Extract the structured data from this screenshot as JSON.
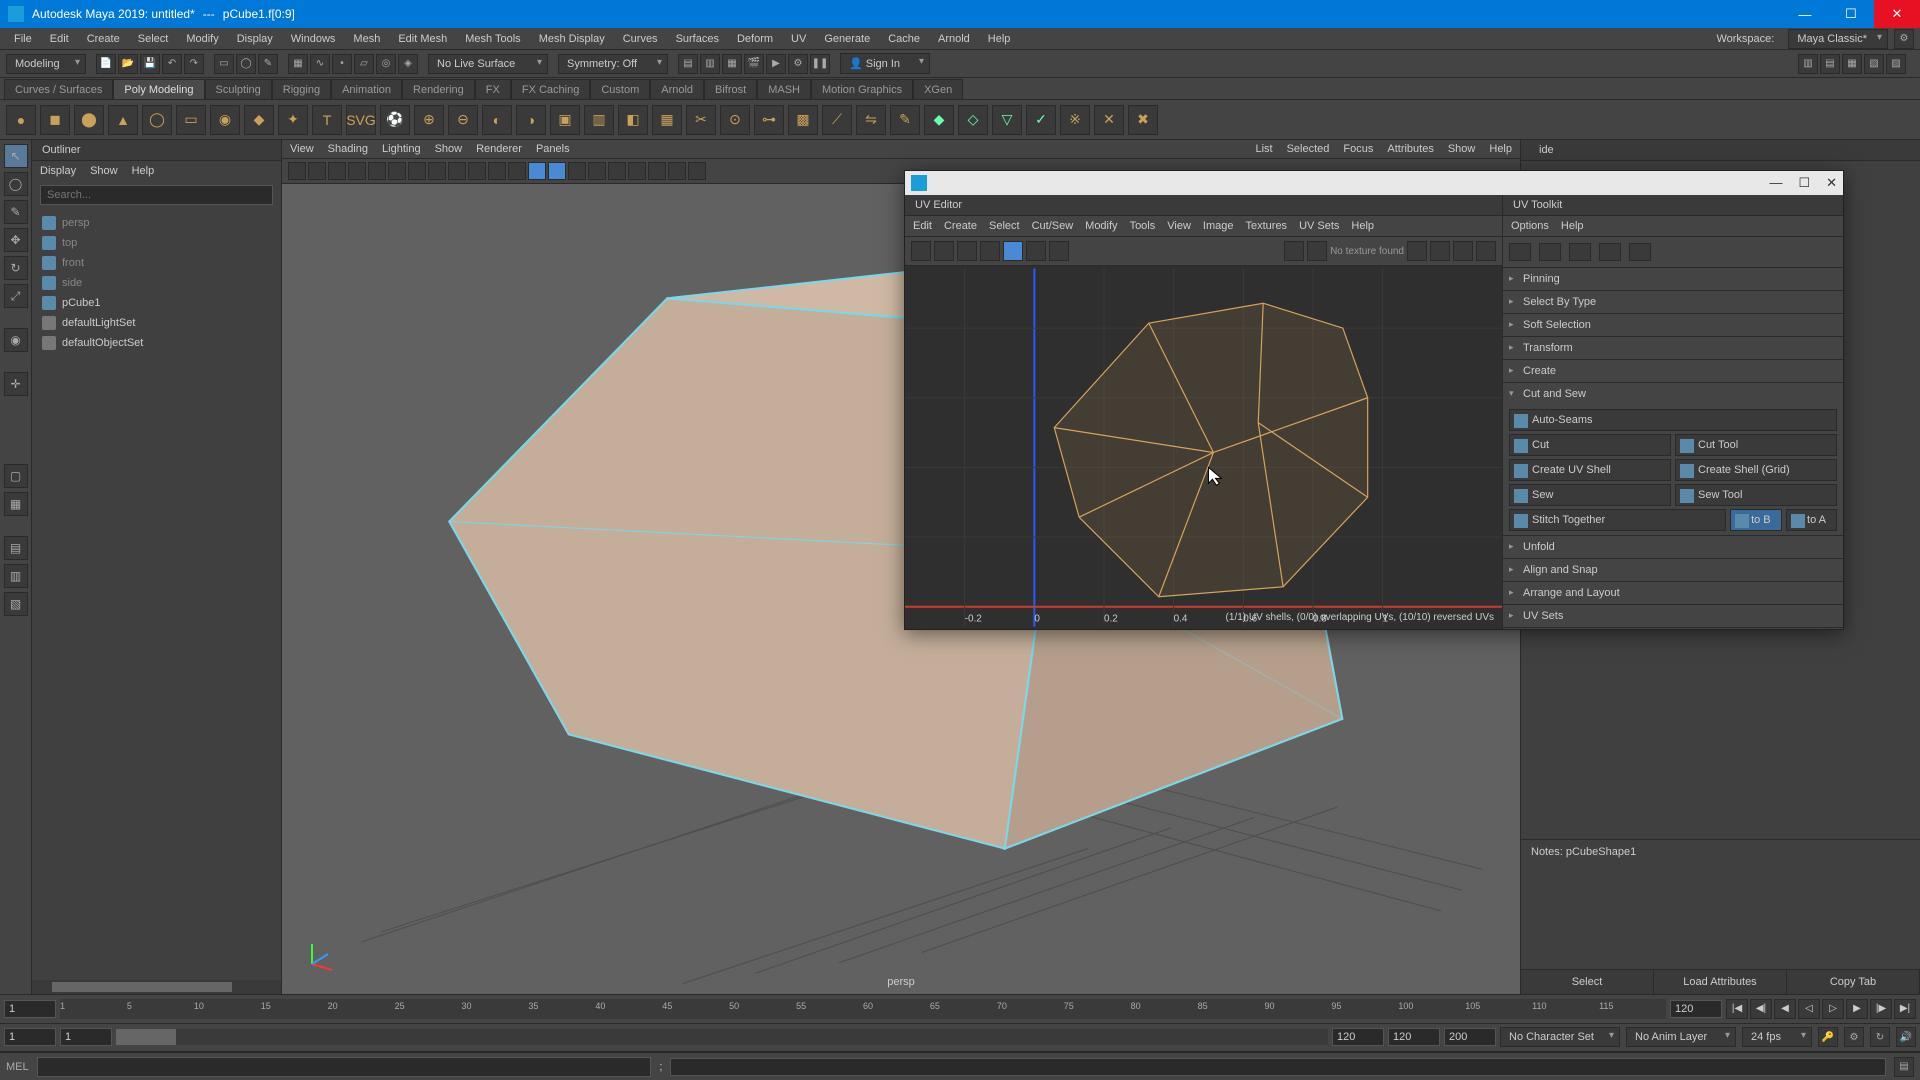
{
  "titlebar": {
    "app": "Autodesk Maya 2019: untitled*",
    "sep": "---",
    "sel": "pCube1.f[0:9]"
  },
  "menubar": {
    "items": [
      "File",
      "Edit",
      "Create",
      "Select",
      "Modify",
      "Display",
      "Windows",
      "Mesh",
      "Edit Mesh",
      "Mesh Tools",
      "Mesh Display",
      "Curves",
      "Surfaces",
      "Deform",
      "UV",
      "Generate",
      "Cache",
      "Arnold",
      "Help"
    ],
    "workspace_lbl": "Workspace:",
    "workspace": "Maya Classic*"
  },
  "toolbar": {
    "mode": "Modeling",
    "livesurf": "No Live Surface",
    "symmetry": "Symmetry: Off",
    "signin": "Sign In"
  },
  "shelf_tabs": [
    "Curves / Surfaces",
    "Poly Modeling",
    "Sculpting",
    "Rigging",
    "Animation",
    "Rendering",
    "FX",
    "FX Caching",
    "Custom",
    "Arnold",
    "Bifrost",
    "MASH",
    "Motion Graphics",
    "XGen"
  ],
  "shelf_active": 1,
  "outliner": {
    "title": "Outliner",
    "menus": [
      "Display",
      "Show",
      "Help"
    ],
    "search_ph": "Search...",
    "items": [
      {
        "name": "persp",
        "dim": true
      },
      {
        "name": "top",
        "dim": true
      },
      {
        "name": "front",
        "dim": true
      },
      {
        "name": "side",
        "dim": true
      },
      {
        "name": "pCube1",
        "dim": false
      },
      {
        "name": "defaultLightSet",
        "dim": false,
        "grey": true
      },
      {
        "name": "defaultObjectSet",
        "dim": false,
        "grey": true
      }
    ]
  },
  "viewport": {
    "menus_l": [
      "View",
      "Shading",
      "Lighting",
      "Show",
      "Renderer",
      "Panels"
    ],
    "menus_r": [
      "List",
      "Selected",
      "Focus",
      "Attributes",
      "Show",
      "Help"
    ],
    "camera": "persp"
  },
  "uv": {
    "editor_title": "UV Editor",
    "editor_menus": [
      "Edit",
      "Create",
      "Select",
      "Cut/Sew",
      "Modify",
      "Tools",
      "View",
      "Image",
      "Textures",
      "UV Sets",
      "Help"
    ],
    "no_tex": "No texture found",
    "status": "(1/1) UV shells, (0/0) overlapping UVs, (10/10) reversed UVs",
    "toolkit_title": "UV Toolkit",
    "toolkit_menus": [
      "Options",
      "Help"
    ],
    "sections": {
      "pinning": "Pinning",
      "selbytype": "Select By Type",
      "softsel": "Soft Selection",
      "transform": "Transform",
      "create": "Create",
      "cutsew": "Cut and Sew",
      "unfold": "Unfold",
      "alignsnap": "Align and Snap",
      "arrange": "Arrange and Layout",
      "uvsets": "UV Sets"
    },
    "cutsew": {
      "autoseams": "Auto-Seams",
      "cut": "Cut",
      "cuttool": "Cut Tool",
      "createshell": "Create UV Shell",
      "createshellgrid": "Create Shell (Grid)",
      "sew": "Sew",
      "sewtool": "Sew Tool",
      "stitch": "Stitch Together",
      "atob": "A to B",
      "btoa": "B to A"
    }
  },
  "attr": {
    "tab": "ide",
    "notes": "Notes:  pCubeShape1",
    "btns": [
      "Select",
      "Load Attributes",
      "Copy Tab"
    ]
  },
  "timeline": {
    "ticks": [
      1,
      5,
      10,
      15,
      20,
      25,
      30,
      35,
      40,
      45,
      50,
      55,
      60,
      65,
      70,
      75,
      80,
      85,
      90,
      95,
      100,
      105,
      110,
      115,
      120
    ],
    "start": "1",
    "end": "120",
    "rs": "1",
    "re": "120",
    "cur": "1",
    "cur2": "120",
    "cur3": "200",
    "charset": "No Character Set",
    "animlayer": "No Anim Layer",
    "fps": "24 fps"
  },
  "cmd": {
    "lang": "MEL"
  }
}
